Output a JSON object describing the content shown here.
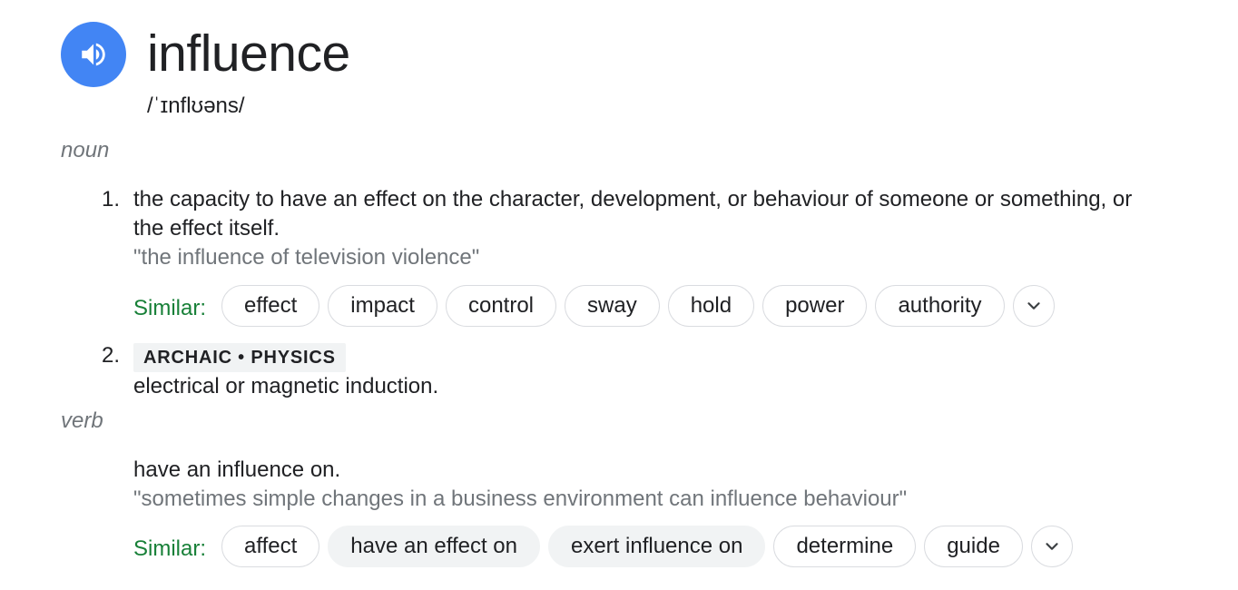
{
  "entry": {
    "word": "influence",
    "pronunciation": "/ˈɪnflʊəns/",
    "speaker_icon": "volume-up-icon"
  },
  "noun": {
    "label": "noun",
    "senses": [
      {
        "number": "1.",
        "definition": "the capacity to have an effect on the character, development, or behaviour of someone or something, or the effect itself.",
        "example": "\"the influence of television violence\"",
        "similar_label": "Similar:",
        "similar": [
          "effect",
          "impact",
          "control",
          "sway",
          "hold",
          "power",
          "authority"
        ]
      },
      {
        "number": "2.",
        "tag": "ARCHAIC • PHYSICS",
        "definition": "electrical or magnetic induction."
      }
    ]
  },
  "verb": {
    "label": "verb",
    "definition": "have an influence on.",
    "example": "\"sometimes simple changes in a business environment can influence behaviour\"",
    "similar_label": "Similar:",
    "similar": [
      "affect",
      "have an effect on",
      "exert influence on",
      "determine",
      "guide"
    ]
  },
  "colors": {
    "accent_blue": "#4285f4",
    "similar_green": "#188038",
    "muted_gray": "#70757a",
    "chip_fill": "#f1f3f4"
  }
}
